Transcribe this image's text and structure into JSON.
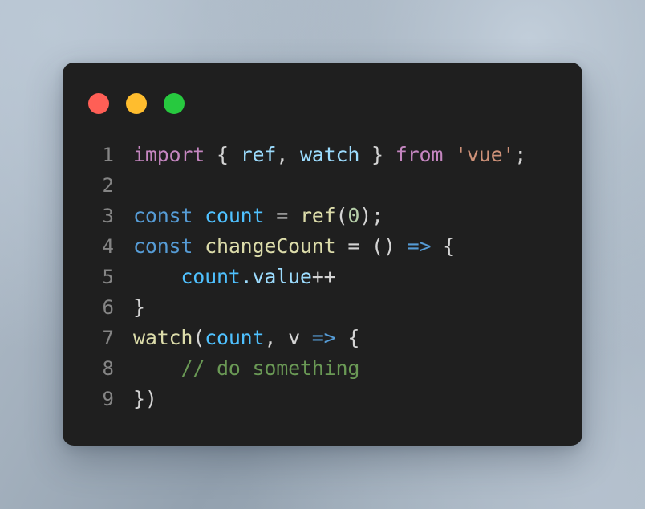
{
  "window": {
    "background_gradient_from": "#b4c0cd",
    "background_gradient_to": "#93a1af",
    "card_background": "#1f1f1f",
    "traffic_lights": [
      {
        "name": "close",
        "color": "#ff5f56"
      },
      {
        "name": "minimize",
        "color": "#ffbd2e"
      },
      {
        "name": "maximize",
        "color": "#27c93f"
      }
    ]
  },
  "editor": {
    "language": "javascript",
    "gutter_color": "#858585",
    "line_numbers": [
      "1",
      "2",
      "3",
      "4",
      "5",
      "6",
      "7",
      "8",
      "9"
    ],
    "lines": [
      {
        "number": "1",
        "text": "import { ref, watch } from 'vue';"
      },
      {
        "number": "2",
        "text": ""
      },
      {
        "number": "3",
        "text": "const count = ref(0);"
      },
      {
        "number": "4",
        "text": "const changeCount = () => {"
      },
      {
        "number": "5",
        "text": "    count.value++"
      },
      {
        "number": "6",
        "text": "}"
      },
      {
        "number": "7",
        "text": "watch(count, v => {"
      },
      {
        "number": "8",
        "text": "    // do something"
      },
      {
        "number": "9",
        "text": "})"
      }
    ],
    "tokens": {
      "l1_import": "import",
      "l1_brace_open": " { ",
      "l1_ref": "ref",
      "l1_comma": ", ",
      "l1_watch": "watch",
      "l1_brace_close": " } ",
      "l1_from": "from",
      "l1_space": " ",
      "l1_string": "'vue'",
      "l1_semi": ";",
      "l3_const": "const",
      "l3_count": " count ",
      "l3_eq": "= ",
      "l3_ref": "ref",
      "l3_paren_open": "(",
      "l3_zero": "0",
      "l3_paren_close": ");",
      "l4_const": "const",
      "l4_name": " changeCount ",
      "l4_eq": "= ",
      "l4_parens": "() ",
      "l4_arrow": "=>",
      "l4_brace": " {",
      "l5_indent": "    ",
      "l5_count": "count",
      "l5_dotvalue": ".value",
      "l5_inc": "++",
      "l6_brace": "}",
      "l7_watch": "watch",
      "l7_paren": "(",
      "l7_count": "count",
      "l7_comma": ", ",
      "l7_v": "v ",
      "l7_arrow": "=>",
      "l7_brace": " {",
      "l8_indent": "    ",
      "l8_comment": "// do something",
      "l9_close": "})"
    }
  }
}
